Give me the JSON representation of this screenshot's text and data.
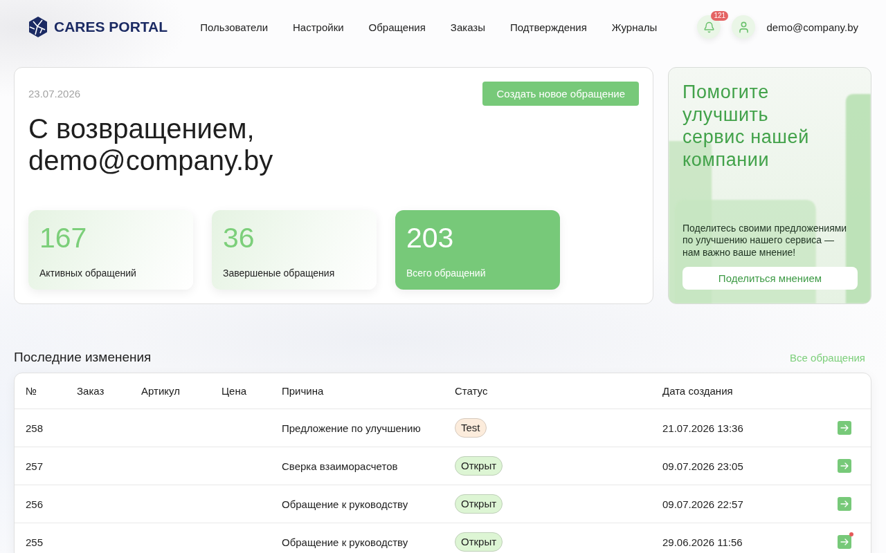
{
  "header": {
    "logo_text": "CARES PORTAL",
    "nav": [
      "Пользователи",
      "Настройки",
      "Обращения",
      "Заказы",
      "Подтверждения",
      "Журналы"
    ],
    "notifications": {
      "count": "121"
    },
    "user_email": "demo@company.by"
  },
  "welcome": {
    "date": "23.07.2026",
    "create_button": "Создать новое обращение",
    "greeting": "С возвращением, demo@company.by",
    "stats": [
      {
        "value": "167",
        "label": "Активных обращений",
        "highlighted": false
      },
      {
        "value": "36",
        "label": "Завершеные обращения",
        "highlighted": false
      },
      {
        "value": "203",
        "label": "Всего обращений",
        "highlighted": true
      }
    ]
  },
  "promo": {
    "title": "Помогите улучшить сервис нашей компании",
    "text": "Поделитесь своими предложениями по улучшению нашего сервиса — нам важно ваше мнение!",
    "button": "Поделиться мнением"
  },
  "recent": {
    "title": "Последние изменения",
    "link": "Все обращения",
    "table": {
      "columns": [
        "№",
        "Заказ",
        "Артикул",
        "Цена",
        "Причина",
        "Статус",
        "Дата создания"
      ],
      "rows": [
        {
          "number": "258",
          "reason": "Предложение по улучшению",
          "status": {
            "label": "Test",
            "color": "#fcecdc"
          },
          "date": "21.07.2026 13:36",
          "unread": false
        },
        {
          "number": "257",
          "reason": "Сверка взаиморасчетов",
          "status": {
            "label": "Открыт",
            "color": "#ddf5d4"
          },
          "date": "09.07.2026 23:05",
          "unread": false
        },
        {
          "number": "256",
          "reason": "Обращение к руководству",
          "status": {
            "label": "Открыт",
            "color": "#ddf5d4"
          },
          "date": "09.07.2026 22:57",
          "unread": false
        },
        {
          "number": "255",
          "reason": "Обращение к руководству",
          "status": {
            "label": "Открыт",
            "color": "#ddf5d4"
          },
          "date": "29.06.2026 11:56",
          "unread": true
        }
      ]
    }
  }
}
